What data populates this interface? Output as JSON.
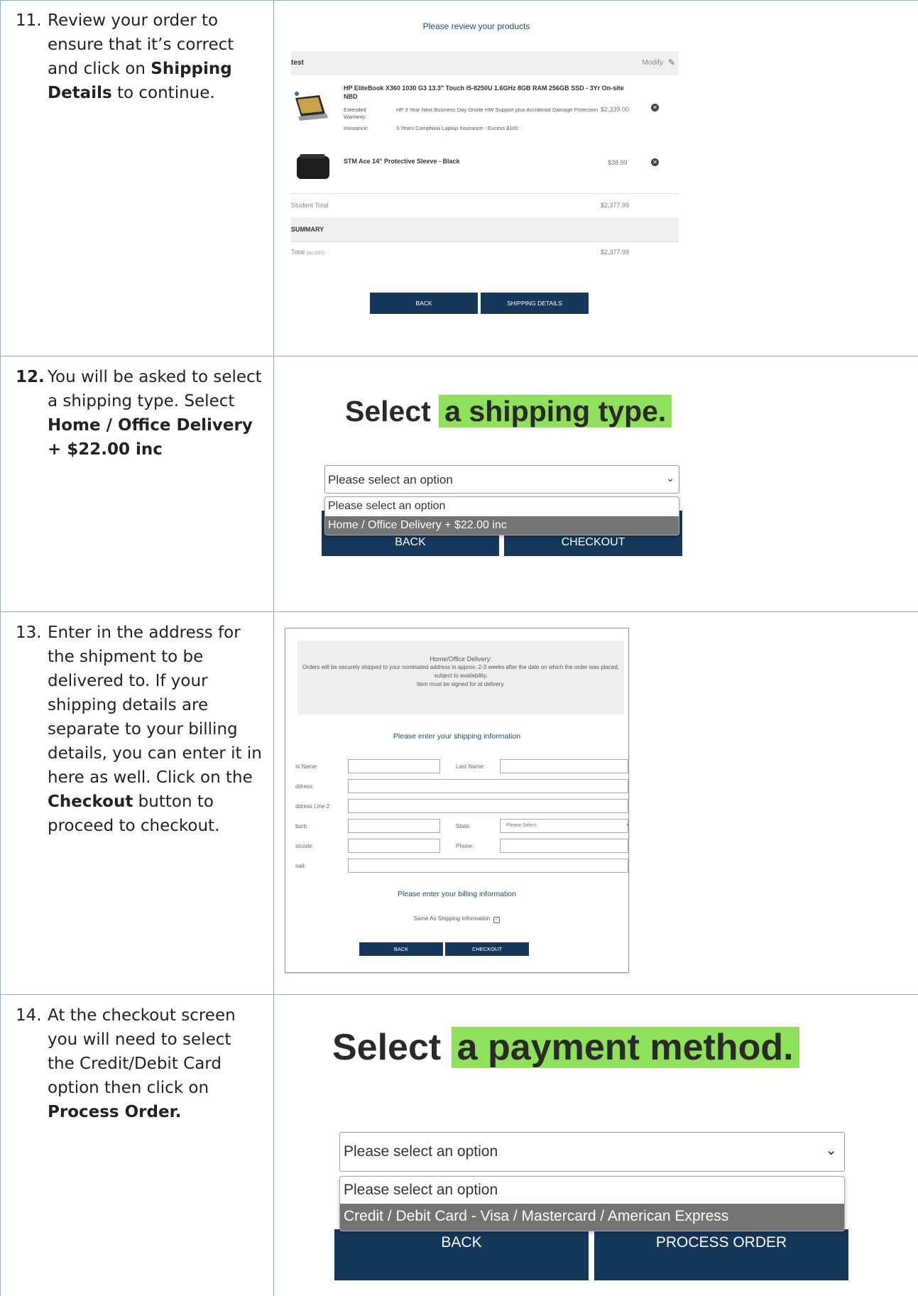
{
  "steps": [
    {
      "num": "11.",
      "text_before": "Review your order to ensure that it’s correct and click on ",
      "bold": "Shipping Details",
      "text_after": " to continue."
    },
    {
      "num": "12.",
      "text_before": "You will be asked to select a shipping type. Select ",
      "bold": "Home / Office Delivery + $22.00 inc",
      "text_after": ""
    },
    {
      "num": "13.",
      "text_before": "Enter in the address for the shipment to be delivered to. If your shipping details are separate to your billing details, you can enter it in here as well. Click on the ",
      "bold": "Checkout",
      "text_after": " button to proceed to checkout."
    },
    {
      "num": "14.",
      "text_before": "At the checkout screen you will need to select the Credit/Debit Card option then click on ",
      "bold": "Process Order.",
      "text_after": ""
    }
  ],
  "review": {
    "title": "Please review your products",
    "user": "test",
    "modify": "Modify",
    "item1_name": "HP EliteBook X360 1030 G3 13.3\" Touch i5-8250U 1.6GHz 8GB RAM 256GB SSD - 3Yr On-site NBD",
    "item1_lab1": "Extended Warranty:",
    "item1_val1": "HP 3 Year Next Business Day Onsite HW Support plus Accidental Damage Protection",
    "item1_lab2": "Insurance:",
    "item1_val2": "3 Years CompNow Laptop Insurance - Excess $100",
    "item1_price": "$2,339.00",
    "item2_name": "STM Ace 14\" Protective Sleeve - Black",
    "item2_price": "$38.99",
    "student_total_label": "Student Total",
    "student_total": "$2,377.99",
    "summary": "SUMMARY",
    "total_label": "Total",
    "total_suffix": "(inc GST)",
    "total": "$2,377.99",
    "back": "BACK",
    "shipping": "SHIPPING DETAILS"
  },
  "shipping": {
    "title_plain": "Select",
    "title_hl": "a shipping type.",
    "select_value": "Please select an option",
    "options": [
      "Please select an option",
      "Home / Office Delivery + $22.00 inc"
    ],
    "back": "BACK",
    "checkout": "CHECKOUT"
  },
  "address": {
    "info_title": "Home/Office Delivery:",
    "info_body": "Orders will be securely shipped to your nominated address in approx. 2-3 weeks after the date on which the order was placed, subject to availability.",
    "info_sign": "Item must be signed for at delivery.",
    "ship_heading": "Please enter your shipping information",
    "first_name": "st Name:",
    "last_name": "Last Name:",
    "addr1": "ddress:",
    "addr2": "ddress Line 2:",
    "suburb": "burb:",
    "state": "State:",
    "state_value": "Please Select",
    "postcode": "stcode:",
    "phone": "Phone:",
    "email": "nail:",
    "bill_heading": "Please enter your billing information",
    "same_as": "Same As Shipping Information",
    "back": "BACK",
    "checkout": "CHECKOUT"
  },
  "payment": {
    "title_plain": "Select",
    "title_hl": "a payment method.",
    "select_value": "Please select an option",
    "options": [
      "Please select an option",
      "Credit / Debit Card - Visa / Mastercard / American Express"
    ],
    "back": "BACK",
    "process": "PROCESS ORDER"
  },
  "colors": {
    "border": "#8eaadb",
    "navy": "#15385a",
    "highlight": "#8fe05a"
  }
}
